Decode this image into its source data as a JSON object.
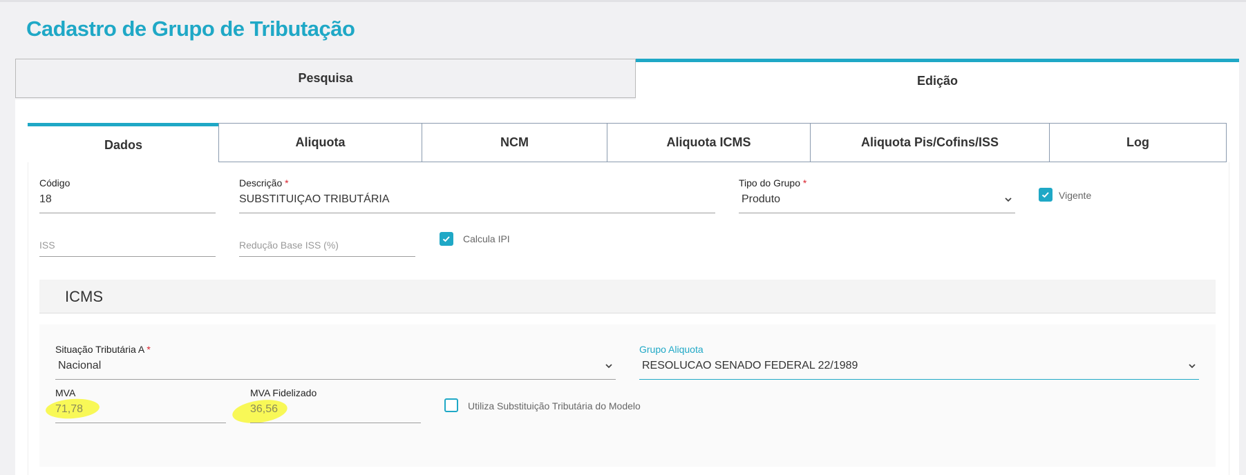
{
  "page": {
    "title": "Cadastro de Grupo de Tributação"
  },
  "main_tabs": [
    {
      "label": "Pesquisa",
      "active": false
    },
    {
      "label": "Edição",
      "active": true
    }
  ],
  "sub_tabs": [
    {
      "label": "Dados",
      "active": true
    },
    {
      "label": "Aliquota",
      "active": false
    },
    {
      "label": "NCM",
      "active": false
    },
    {
      "label": "Aliquota ICMS",
      "active": false
    },
    {
      "label": "Aliquota Pis/Cofins/ISS",
      "active": false
    },
    {
      "label": "Log",
      "active": false
    }
  ],
  "form": {
    "codigo": {
      "label": "Código",
      "value": "18"
    },
    "descricao": {
      "label": "Descrição",
      "required_mark": "*",
      "value": "SUBSTITUIÇAO TRIBUTÁRIA"
    },
    "tipo_grupo": {
      "label": "Tipo do Grupo",
      "required_mark": "*",
      "value": "Produto"
    },
    "vigente": {
      "label": "Vigente",
      "checked": true
    },
    "iss": {
      "placeholder": "ISS",
      "value": ""
    },
    "reducao_base_iss": {
      "placeholder": "Redução Base ISS (%)",
      "value": ""
    },
    "calcula_ipi": {
      "label": "Calcula IPI",
      "checked": true
    }
  },
  "icms": {
    "section_title": "ICMS",
    "situacao_tributaria": {
      "label": "Situação Tributária A",
      "required_mark": "*",
      "value": "Nacional"
    },
    "grupo_aliquota": {
      "label": "Grupo Aliquota",
      "value": "RESOLUCAO SENADO FEDERAL 22/1989"
    },
    "mva": {
      "label": "MVA",
      "value": "71,78"
    },
    "mva_fidelizado": {
      "label": "MVA Fidelizado",
      "value": "36,56"
    },
    "utiliza_st_modelo": {
      "label": "Utiliza Substituição Tributária do Modelo",
      "checked": false
    }
  },
  "icons": [
    "chevron-down-icon",
    "checkmark-icon"
  ],
  "colors": {
    "accent": "#1fa8c6",
    "required": "#d9232e",
    "highlight": "#f7f73a"
  }
}
